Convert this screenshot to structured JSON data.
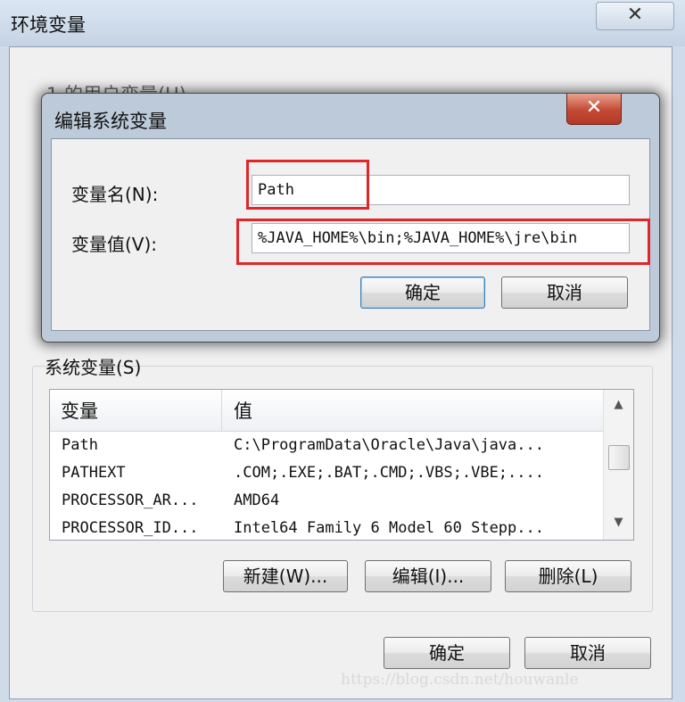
{
  "outer": {
    "title": "环境变量",
    "close_glyph": "✕",
    "user_section_label": "1 的用户变量(U)"
  },
  "edit_dialog": {
    "title": "编辑系统变量",
    "close_glyph": "✕",
    "name_label": "变量名(N):",
    "name_value": "Path",
    "value_label": "变量值(V):",
    "value_value": "%JAVA_HOME%\\bin;%JAVA_HOME%\\jre\\bin",
    "ok_label": "确定",
    "cancel_label": "取消"
  },
  "system_vars": {
    "label": "系统变量(S)",
    "columns": [
      "变量",
      "值"
    ],
    "rows": [
      {
        "name": "Path",
        "value": "C:\\ProgramData\\Oracle\\Java\\java..."
      },
      {
        "name": "PATHEXT",
        "value": ".COM;.EXE;.BAT;.CMD;.VBS;.VBE;...."
      },
      {
        "name": "PROCESSOR_AR...",
        "value": "AMD64"
      },
      {
        "name": "PROCESSOR_ID...",
        "value": "Intel64 Family 6 Model 60 Stepp..."
      }
    ],
    "new_label": "新建(W)...",
    "edit_label": "编辑(I)...",
    "delete_label": "删除(L)"
  },
  "footer": {
    "ok_label": "确定",
    "cancel_label": "取消"
  },
  "watermark": "https://blog.csdn.net/houwanle",
  "colors": {
    "highlight": "#e0262a",
    "close_button": "#c44a34"
  }
}
